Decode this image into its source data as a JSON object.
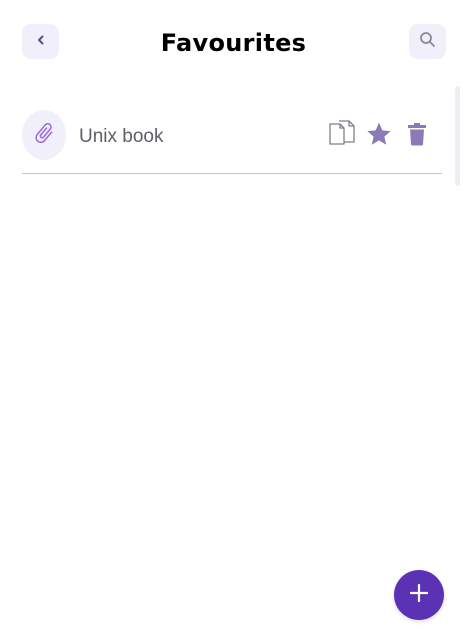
{
  "header": {
    "title": "Favourites",
    "back_icon": "chevron-left-icon",
    "search_icon": "search-icon"
  },
  "favourites": [
    {
      "label": "Unix book",
      "avatar_icon": "paperclip-icon",
      "actions": [
        "copy-icon",
        "star-icon",
        "delete-icon"
      ]
    }
  ],
  "fab": {
    "icon": "plus-icon"
  },
  "colors": {
    "accent": "#5b32b4",
    "icon_tint": "#8a7ab8",
    "button_bg": "#f1effa",
    "label_text": "#5f5f66",
    "divider": "#c6c4cc"
  }
}
